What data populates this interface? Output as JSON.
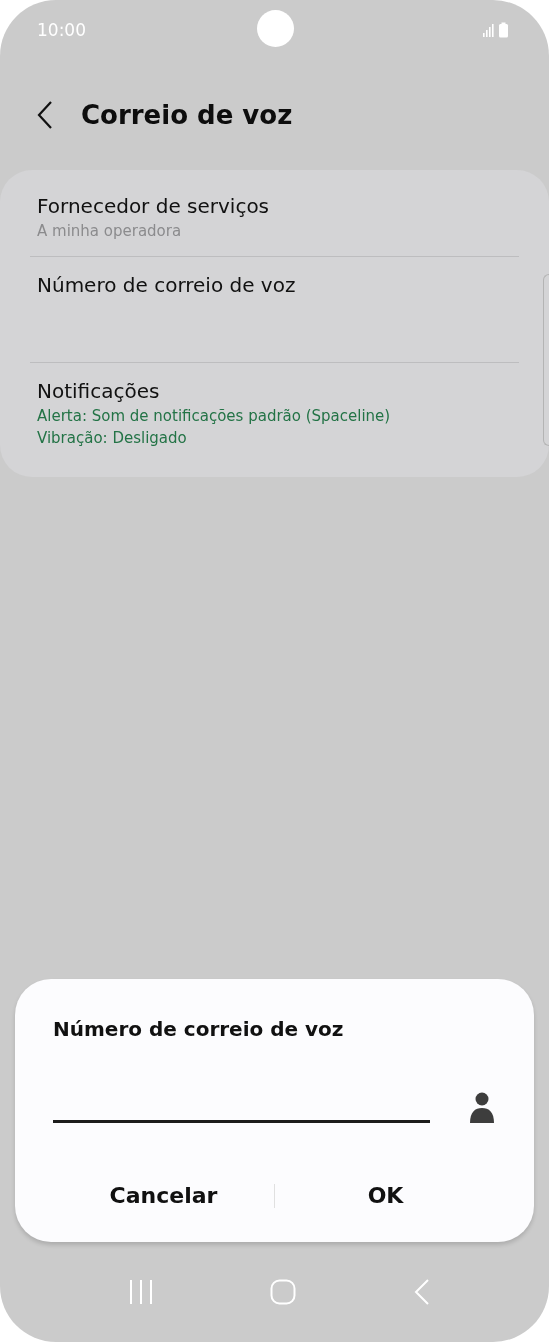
{
  "status_bar": {
    "time": "10:00"
  },
  "header": {
    "title": "Correio de voz"
  },
  "settings": [
    {
      "kind": "value",
      "title": "Fornecedor de serviços",
      "subtitles": [
        "A minha operadora"
      ]
    },
    {
      "kind": "plain",
      "title": "Número de correio de voz"
    },
    {
      "kind": "status",
      "title": "Notificações",
      "subtitles": [
        "Alerta: Som de notificações padrão (Spaceline)",
        "Vibração: Desligado"
      ]
    }
  ],
  "dialog": {
    "title": "Número de correio de voz",
    "buttons": [
      "Cancelar",
      "OK"
    ]
  }
}
